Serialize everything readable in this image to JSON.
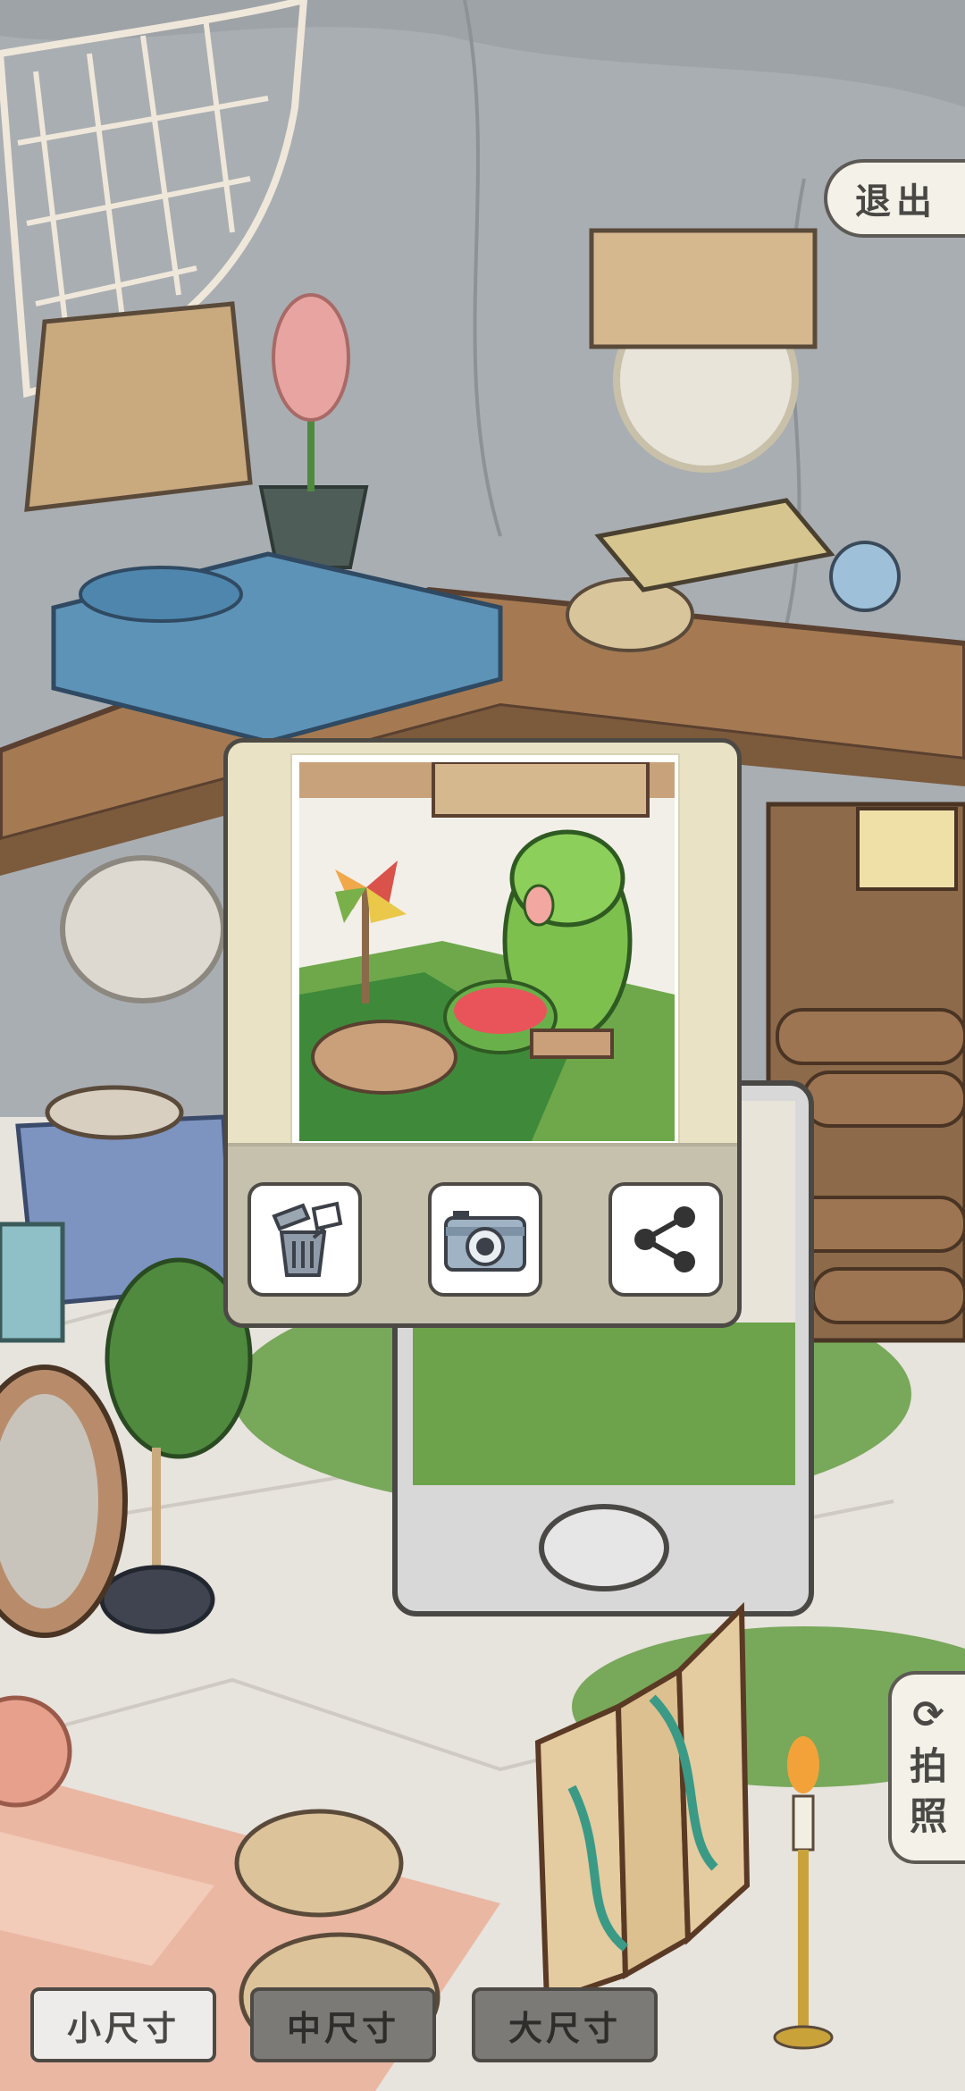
{
  "header": {
    "exit_label": "退出"
  },
  "side": {
    "photo_label_1": "拍",
    "photo_label_2": "照"
  },
  "size_options": [
    {
      "label": "小尺寸",
      "selected": true
    },
    {
      "label": "中尺寸",
      "selected": false
    },
    {
      "label": "大尺寸",
      "selected": false
    }
  ],
  "photo_panel": {
    "actions": [
      {
        "icon": "trash-icon"
      },
      {
        "icon": "camera-icon"
      },
      {
        "icon": "share-icon"
      }
    ]
  },
  "colors": {
    "wall": "#a7acb0",
    "wood": "#9a7454",
    "floor": "#e6e2dc",
    "rug": "#e8b9a4",
    "frog": "#7dc04e"
  }
}
